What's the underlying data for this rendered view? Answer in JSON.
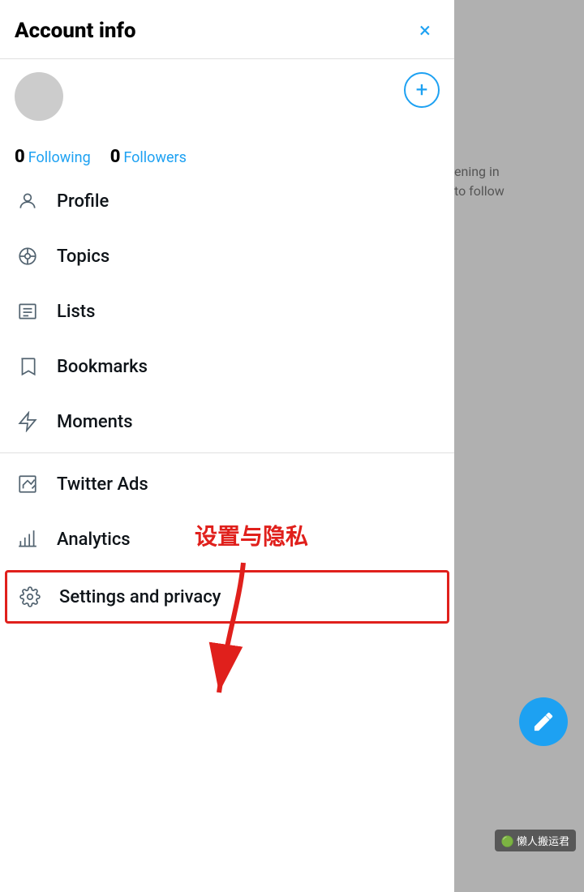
{
  "header": {
    "title": "Account info",
    "close_label": "×"
  },
  "add_button_label": "+",
  "stats": {
    "following": {
      "number": "0",
      "label": "Following"
    },
    "followers": {
      "number": "0",
      "label": "Followers"
    }
  },
  "menu": {
    "items": [
      {
        "id": "profile",
        "label": "Profile",
        "icon": "person-icon"
      },
      {
        "id": "topics",
        "label": "Topics",
        "icon": "topics-icon"
      },
      {
        "id": "lists",
        "label": "Lists",
        "icon": "lists-icon"
      },
      {
        "id": "bookmarks",
        "label": "Bookmarks",
        "icon": "bookmarks-icon"
      },
      {
        "id": "moments",
        "label": "Moments",
        "icon": "moments-icon"
      },
      {
        "id": "twitter-ads",
        "label": "Twitter Ads",
        "icon": "ads-icon"
      },
      {
        "id": "analytics",
        "label": "Analytics",
        "icon": "analytics-icon"
      },
      {
        "id": "settings",
        "label": "Settings and privacy",
        "icon": "settings-icon"
      }
    ]
  },
  "annotation": {
    "text": "设置与隐私"
  },
  "background": {
    "text_line1": "ening in",
    "text_line2": "to follow"
  },
  "fab_label": "+✎",
  "wechat_label": "懒人搬运君"
}
